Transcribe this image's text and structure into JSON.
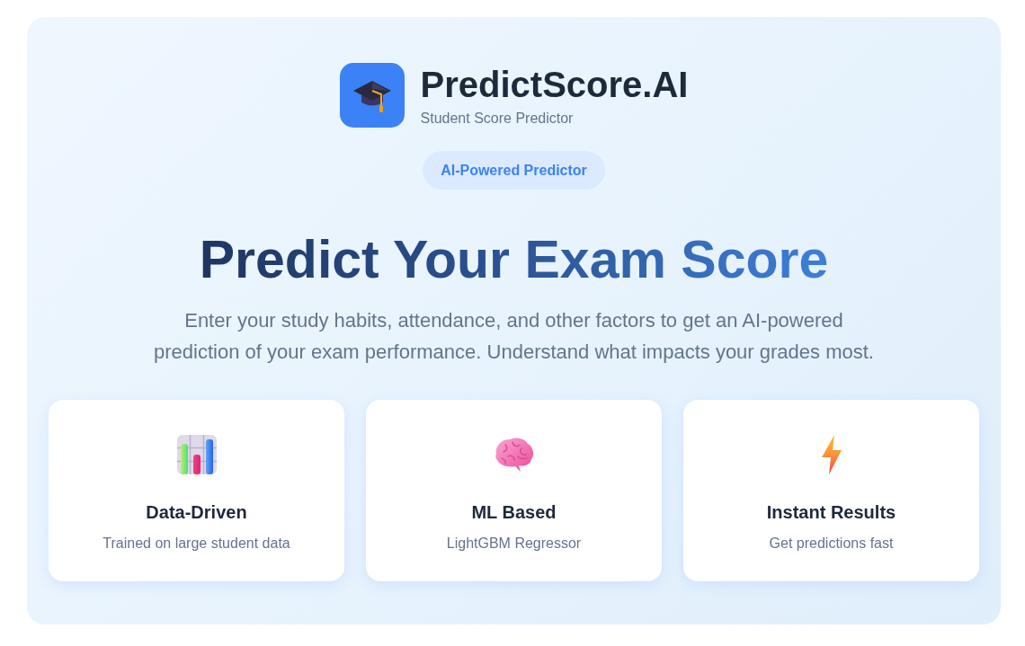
{
  "brand": {
    "title": "PredictScore.AI",
    "subtitle": "Student Score Predictor"
  },
  "badge": "AI-Powered Predictor",
  "headline": "Predict Your Exam Score",
  "description": "Enter your study habits, attendance, and other factors to get an AI-powered prediction of your exam performance. Understand what impacts your grades most.",
  "features": [
    {
      "kind": "chart",
      "title": "Data-Driven",
      "subtitle": "Trained on large student data"
    },
    {
      "kind": "brain",
      "title": "ML Based",
      "subtitle": "LightGBM Regressor"
    },
    {
      "kind": "lightning",
      "title": "Instant Results",
      "subtitle": "Get predictions fast"
    }
  ]
}
